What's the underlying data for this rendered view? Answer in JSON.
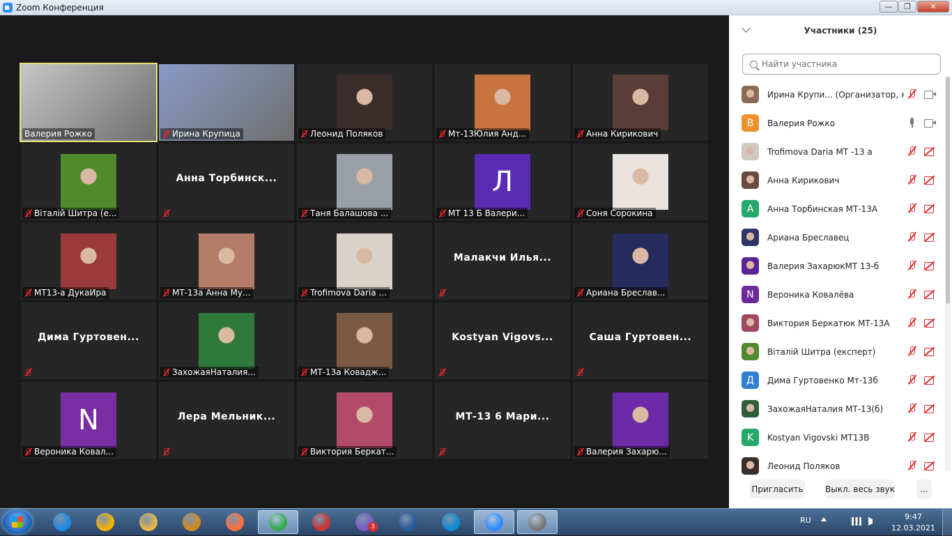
{
  "window": {
    "title": "Zoom Конференция",
    "min": "—",
    "max": "❐",
    "close": "✕"
  },
  "tiles": [
    {
      "name": "Валерия Рожко",
      "kind": "video",
      "color": "#c7c7c7",
      "active": true,
      "muted": false
    },
    {
      "name": "Ирина Крупица",
      "kind": "video",
      "color": "#8a9bc6",
      "muted": true
    },
    {
      "name": "Леонид Поляков",
      "kind": "photo",
      "color": "#3b2d2b",
      "muted": true
    },
    {
      "name": "Мт-13Юлия Анд...",
      "kind": "photo",
      "color": "#c9743f",
      "muted": true
    },
    {
      "name": "Анна Кирикович",
      "kind": "photo",
      "color": "#5a3d38",
      "muted": true
    },
    {
      "name": "Віталій Шитра (е...",
      "kind": "photo",
      "color": "#4f8b2c",
      "muted": true
    },
    {
      "name": "",
      "display": "Анна  Торбинск...",
      "kind": "text",
      "muted": true
    },
    {
      "name": "Таня Балашова ...",
      "kind": "photo",
      "color": "#9aa0a6",
      "muted": true
    },
    {
      "name": "МТ 13 Б Валери...",
      "kind": "initial",
      "initial": "Л",
      "color": "#5b2bb3",
      "muted": true
    },
    {
      "name": "Соня Сорокина",
      "kind": "photo",
      "color": "#e9e4e0",
      "muted": true
    },
    {
      "name": "МТ13-а ДукаИра",
      "kind": "photo",
      "color": "#9b3a3a",
      "muted": true
    },
    {
      "name": "МТ-13а Анна Му...",
      "kind": "photo",
      "color": "#b37d6a",
      "muted": true
    },
    {
      "name": "Trofimova Daria ...",
      "kind": "photo",
      "color": "#d9d3cb",
      "muted": true
    },
    {
      "name": "",
      "display": "Малакчи  Илья...",
      "kind": "text",
      "muted": true
    },
    {
      "name": "Ариана Бреслав...",
      "kind": "photo",
      "color": "#262b5e",
      "muted": true
    },
    {
      "name": "",
      "display": "Дима  Гуртовен...",
      "kind": "text",
      "muted": true
    },
    {
      "name": "ЗахожаяНаталия...",
      "kind": "photo",
      "color": "#2f7a3a",
      "muted": true
    },
    {
      "name": "МТ-13а Ковадж...",
      "kind": "photo",
      "color": "#7a5a43",
      "muted": true
    },
    {
      "name": "",
      "display": "Kostyan  Vigovs...",
      "kind": "text",
      "muted": true
    },
    {
      "name": "",
      "display": "Саша  Гуртовен...",
      "kind": "text",
      "muted": true
    },
    {
      "name": "Вероника Ковал...",
      "kind": "initial",
      "initial": "N",
      "color": "#7a2ea3",
      "muted": true
    },
    {
      "name": "",
      "display": "Лера  Мельник...",
      "kind": "text",
      "muted": true
    },
    {
      "name": "Виктория Беркат...",
      "kind": "photo",
      "color": "#b24a6a",
      "muted": true
    },
    {
      "name": "",
      "display": "МТ-13  6  Мари...",
      "kind": "text",
      "muted": true
    },
    {
      "name": "Валерия Захарю...",
      "kind": "photo",
      "color": "#6b2aa6",
      "muted": true
    }
  ],
  "panel": {
    "title": "Участники (25)",
    "search_placeholder": "Найти участника",
    "participants": [
      {
        "name": "Ирина Крупи...  (Организатор, я)",
        "avatar": "",
        "color": "#8a6a55",
        "mic": "muted",
        "cam": "on"
      },
      {
        "name": "Валерия Рожко",
        "avatar": "В",
        "color": "#f0902a",
        "mic": "on",
        "cam": "on"
      },
      {
        "name": "Trofimova Daria МТ -13 а",
        "avatar": "",
        "color": "#cfc8be",
        "mic": "muted",
        "cam": "off"
      },
      {
        "name": "Анна Кирикович",
        "avatar": "",
        "color": "#6b4a42",
        "mic": "muted",
        "cam": "off"
      },
      {
        "name": "Анна Торбинская МТ-13А",
        "avatar": "А",
        "color": "#25a86b",
        "mic": "muted",
        "cam": "off"
      },
      {
        "name": "Ариана Бреславец",
        "avatar": "",
        "color": "#2e3468",
        "mic": "muted",
        "cam": "off"
      },
      {
        "name": "Валерия ЗахарюкМТ 13-б",
        "avatar": "",
        "color": "#5a2396",
        "mic": "muted",
        "cam": "off"
      },
      {
        "name": "Вероника Ковалёва",
        "avatar": "N",
        "color": "#6c2a9a",
        "mic": "muted",
        "cam": "off"
      },
      {
        "name": "Виктория Беркатюк МТ-13А",
        "avatar": "",
        "color": "#a2475e",
        "mic": "muted",
        "cam": "off"
      },
      {
        "name": "Віталій Шитра (експерт)",
        "avatar": "",
        "color": "#4f8b2c",
        "mic": "muted",
        "cam": "off"
      },
      {
        "name": "Дима Гуртовенко Мт-13б",
        "avatar": "Д",
        "color": "#2f7fd0",
        "mic": "muted",
        "cam": "off"
      },
      {
        "name": "ЗахожаяНаталия МТ-13(б)",
        "avatar": "",
        "color": "#2f5e3a",
        "mic": "muted",
        "cam": "off"
      },
      {
        "name": "Kostyan Vigovski МТ13В",
        "avatar": "K",
        "color": "#25a86b",
        "mic": "muted",
        "cam": "off"
      },
      {
        "name": "Леонид Поляков",
        "avatar": "",
        "color": "#3b2d2b",
        "mic": "muted",
        "cam": "off"
      }
    ],
    "invite": "Пригласить",
    "mute_all": "Выкл. весь звук",
    "more": "..."
  },
  "taskbar": {
    "lang": "RU",
    "time": "9:47",
    "date": "12.03.2021",
    "viber_badge": "3",
    "apps": [
      {
        "name": "internet-explorer",
        "color": "#1e88e5"
      },
      {
        "name": "chrome-app",
        "color": "#f4b400"
      },
      {
        "name": "file-explorer",
        "color": "#e8b64a"
      },
      {
        "name": "archive-app",
        "color": "#d08a1a"
      },
      {
        "name": "firefox",
        "color": "#ff7139"
      },
      {
        "name": "chrome",
        "color": "#34a853",
        "sel": true
      },
      {
        "name": "photo-app",
        "color": "#c33"
      },
      {
        "name": "viber",
        "color": "#7d5ac8"
      },
      {
        "name": "word",
        "color": "#2b579a"
      },
      {
        "name": "edge",
        "color": "#0c8bd6"
      },
      {
        "name": "zoom",
        "color": "#2d8cff",
        "sel": true
      },
      {
        "name": "camera-app",
        "color": "#777",
        "sel": true
      }
    ]
  }
}
